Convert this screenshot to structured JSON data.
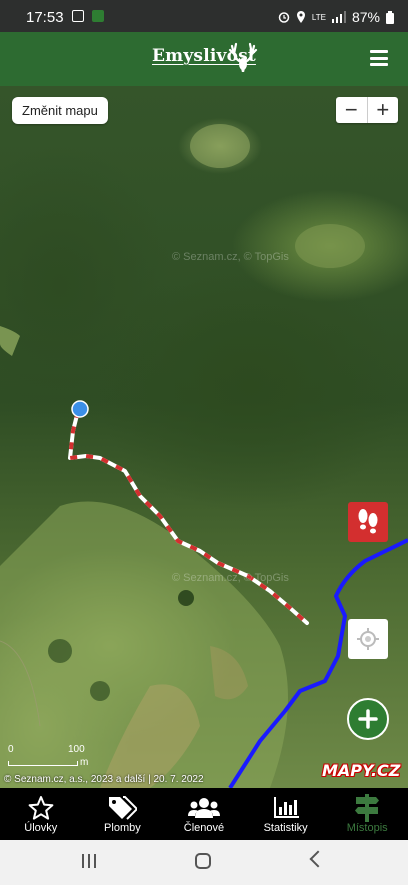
{
  "status_bar": {
    "time": "17:53",
    "network": "LTE",
    "battery": "87%"
  },
  "header": {
    "title": "Emyslivost"
  },
  "map": {
    "change_map_label": "Změnit mapu",
    "zoom_out": "−",
    "zoom_in": "+",
    "watermark": "© Seznam.cz, © TopGis",
    "scale_zero": "0",
    "scale_value": "100",
    "scale_unit": "m",
    "attribution": "© Seznam.cz, a.s., 2023 a další | 20. 7. 2022",
    "provider_logo": "MAPY.CZ",
    "colors": {
      "track_red": "#d32f2f",
      "track_white": "#ffffff",
      "river": "#1a1aff",
      "location_dot": "#3b8fe8"
    }
  },
  "bottom_nav": {
    "items": [
      {
        "label": "Úlovky",
        "icon": "star-icon"
      },
      {
        "label": "Plomby",
        "icon": "tags-icon"
      },
      {
        "label": "Členové",
        "icon": "users-icon"
      },
      {
        "label": "Statistiky",
        "icon": "bar-chart-icon"
      },
      {
        "label": "Místopis",
        "icon": "signpost-icon",
        "active": true
      }
    ]
  }
}
